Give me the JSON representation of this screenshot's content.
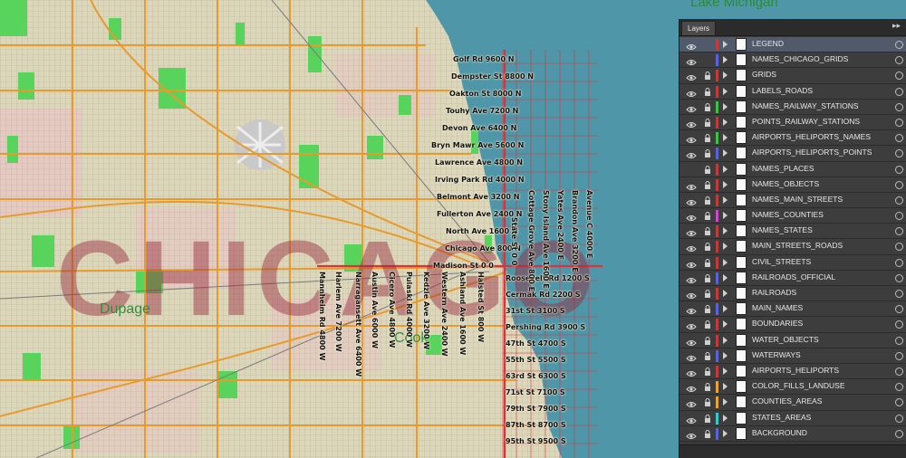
{
  "map": {
    "lake_label": "Lake Michigan",
    "county_labels": [
      "Dupage",
      "Cook"
    ],
    "watermark_text": "CHICAGO",
    "north_streets": [
      "Golf Rd 9600 N",
      "Dempster St 8800 N",
      "Oakton St 8000 N",
      "Touhy Ave 7200 N",
      "Devon Ave 6400 N",
      "Bryn Mawr Ave 5600 N",
      "Lawrence Ave 4800 N",
      "Irving Park Rd 4000 N",
      "Belmont Ave 3200 N",
      "Fullerton Ave 2400 N",
      "North Ave 1600 N",
      "Chicago Ave 800 N",
      "Madison St 0 0"
    ],
    "south_streets": [
      "Roosevelt Rd 1200 S",
      "Cermak Rd 2200 S",
      "31st St 3100 S",
      "Pershing Rd 3900 S",
      "47th St 4700 S",
      "55th St 5500 S",
      "63rd St 6300 S",
      "71st St 7100 S",
      "79th St 7900 S",
      "87th St 8700 S",
      "95th St 9500 S"
    ],
    "east_streets": [
      "State St 0 0",
      "Cottage Grove Ave 800 E",
      "Stony Island Ave 1600 E",
      "Yates Ave 2400 E",
      "Brandon Ave 3200 E",
      "Avenue C 4000 E"
    ],
    "west_streets": [
      "Mannheim Rd 4800 W",
      "Harlem Ave 7200 W",
      "Narragansett Ave 6400 W",
      "Austin Ave 6000 W",
      "Cicero Ave 4800 W",
      "Pulaski Rd 4000 W",
      "Kedzie Ave 3200 W",
      "Western Ave 2400 W",
      "Ashland Ave 1600 W",
      "Halsted St 800 W"
    ],
    "colors": {
      "water": "#4f97a8",
      "land": "#d8d3b5",
      "park": "#58d35c",
      "grid_line": "#d9343a",
      "main_road": "#e89a2a"
    }
  },
  "layers_panel": {
    "tab_label": "Layers",
    "menu_icon": "▸▸",
    "layers": [
      {
        "name": "LEGEND",
        "color": "#c23b3b",
        "locked": false,
        "visible": true,
        "selected": true
      },
      {
        "name": "NAMES_CHICAGO_GRIDS",
        "color": "#5a63d8",
        "locked": false,
        "visible": true,
        "selected": false
      },
      {
        "name": "GRIDS",
        "color": "#c23b3b",
        "locked": true,
        "visible": true,
        "selected": false
      },
      {
        "name": "LABELS_ROADS",
        "color": "#c23b3b",
        "locked": true,
        "visible": true,
        "selected": false
      },
      {
        "name": "NAMES_RAILWAY_STATIONS",
        "color": "#3ac24a",
        "locked": true,
        "visible": true,
        "selected": false
      },
      {
        "name": "POINTS_RAILWAY_STATIONS",
        "color": "#c23b3b",
        "locked": true,
        "visible": true,
        "selected": false
      },
      {
        "name": "AIRPORTS_HELIPORTS_NAMES",
        "color": "#3ac24a",
        "locked": true,
        "visible": true,
        "selected": false
      },
      {
        "name": "AIRPORTS_HELIPORTS_POINTS",
        "color": "#5a63d8",
        "locked": true,
        "visible": true,
        "selected": false
      },
      {
        "name": "NAMES_PLACES",
        "color": "#c23b3b",
        "locked": true,
        "visible": false,
        "selected": false
      },
      {
        "name": "NAMES_OBJECTS",
        "color": "#c23b3b",
        "locked": true,
        "visible": true,
        "selected": false
      },
      {
        "name": "NAMES_MAIN_STREETS",
        "color": "#c23b3b",
        "locked": true,
        "visible": true,
        "selected": false
      },
      {
        "name": "NAMES_COUNTIES",
        "color": "#c84cc8",
        "locked": true,
        "visible": true,
        "selected": false
      },
      {
        "name": "NAMES_STATES",
        "color": "#c23b3b",
        "locked": true,
        "visible": true,
        "selected": false
      },
      {
        "name": "MAIN_STREETS_ROADS",
        "color": "#c23b3b",
        "locked": true,
        "visible": true,
        "selected": false
      },
      {
        "name": "CIVIL_STREETS",
        "color": "#c23b3b",
        "locked": true,
        "visible": true,
        "selected": false
      },
      {
        "name": "RAILROADS_OFFICIAL",
        "color": "#5a63d8",
        "locked": true,
        "visible": true,
        "selected": false
      },
      {
        "name": "RAILROADS",
        "color": "#c23b3b",
        "locked": true,
        "visible": true,
        "selected": false
      },
      {
        "name": "MAIN_NAMES",
        "color": "#5a63d8",
        "locked": true,
        "visible": true,
        "selected": false
      },
      {
        "name": "BOUNDARIES",
        "color": "#c23b3b",
        "locked": true,
        "visible": true,
        "selected": false
      },
      {
        "name": "WATER_OBJECTS",
        "color": "#c23b3b",
        "locked": true,
        "visible": true,
        "selected": false
      },
      {
        "name": "WATERWAYS",
        "color": "#5a63d8",
        "locked": true,
        "visible": true,
        "selected": false
      },
      {
        "name": "AIRPORTS_HELIPORTS",
        "color": "#c23b3b",
        "locked": true,
        "visible": true,
        "selected": false
      },
      {
        "name": "COLOR_FILLS_LANDUSE",
        "color": "#e8a23a",
        "locked": true,
        "visible": true,
        "selected": false
      },
      {
        "name": "COUNTIES_AREAS",
        "color": "#e8a23a",
        "locked": true,
        "visible": true,
        "selected": false
      },
      {
        "name": "STATES_AREAS",
        "color": "#3ac8c8",
        "locked": true,
        "visible": true,
        "selected": false
      },
      {
        "name": "BACKGROUND",
        "color": "#5a63d8",
        "locked": true,
        "visible": true,
        "selected": false
      }
    ]
  }
}
